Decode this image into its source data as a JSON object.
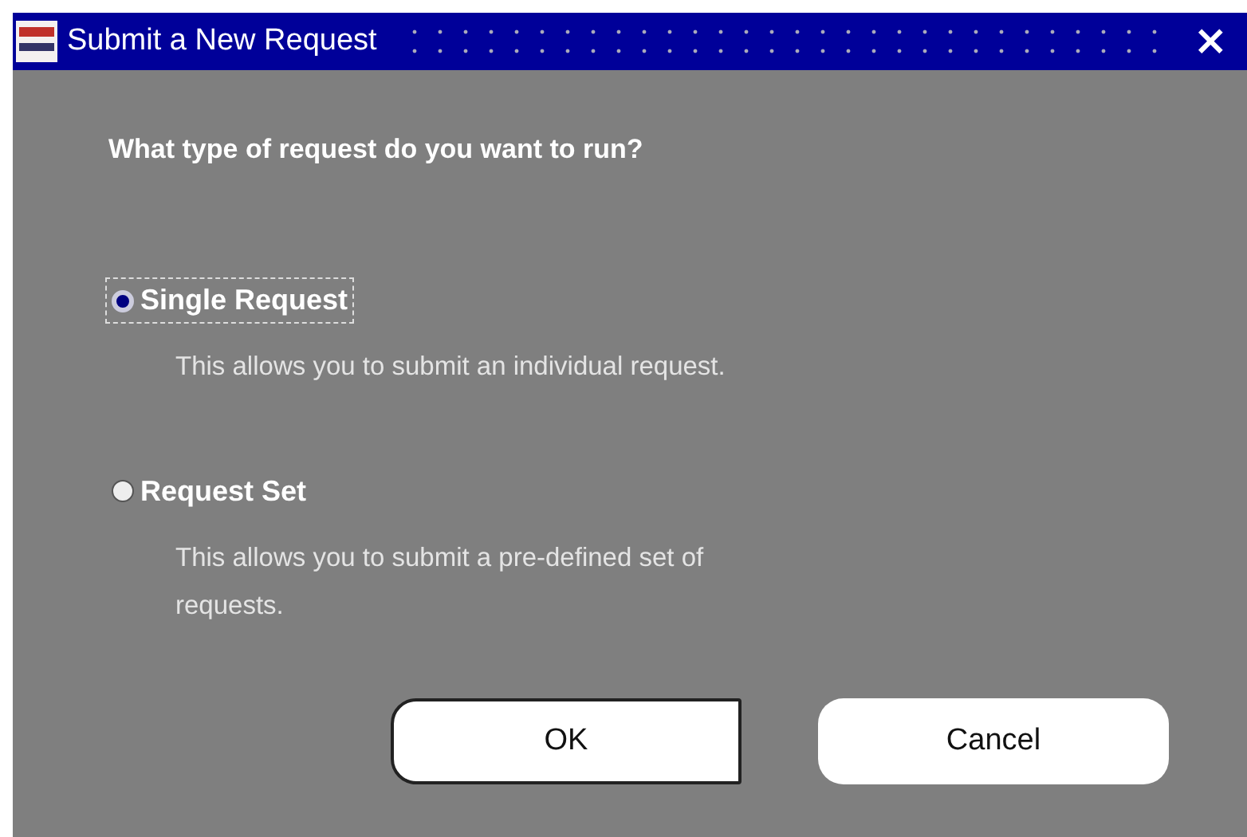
{
  "window": {
    "title": "Submit a New Request",
    "close": "×"
  },
  "question": "What type of request do you want to run?",
  "options": [
    {
      "label": "Single Request",
      "description": "This allows you to submit an individual request.",
      "selected": true
    },
    {
      "label": "Request Set",
      "description": "This allows you to submit a pre-defined set of requests.",
      "selected": false
    }
  ],
  "buttons": [
    {
      "label": "OK",
      "default": true
    },
    {
      "label": "Cancel",
      "default": false
    }
  ]
}
